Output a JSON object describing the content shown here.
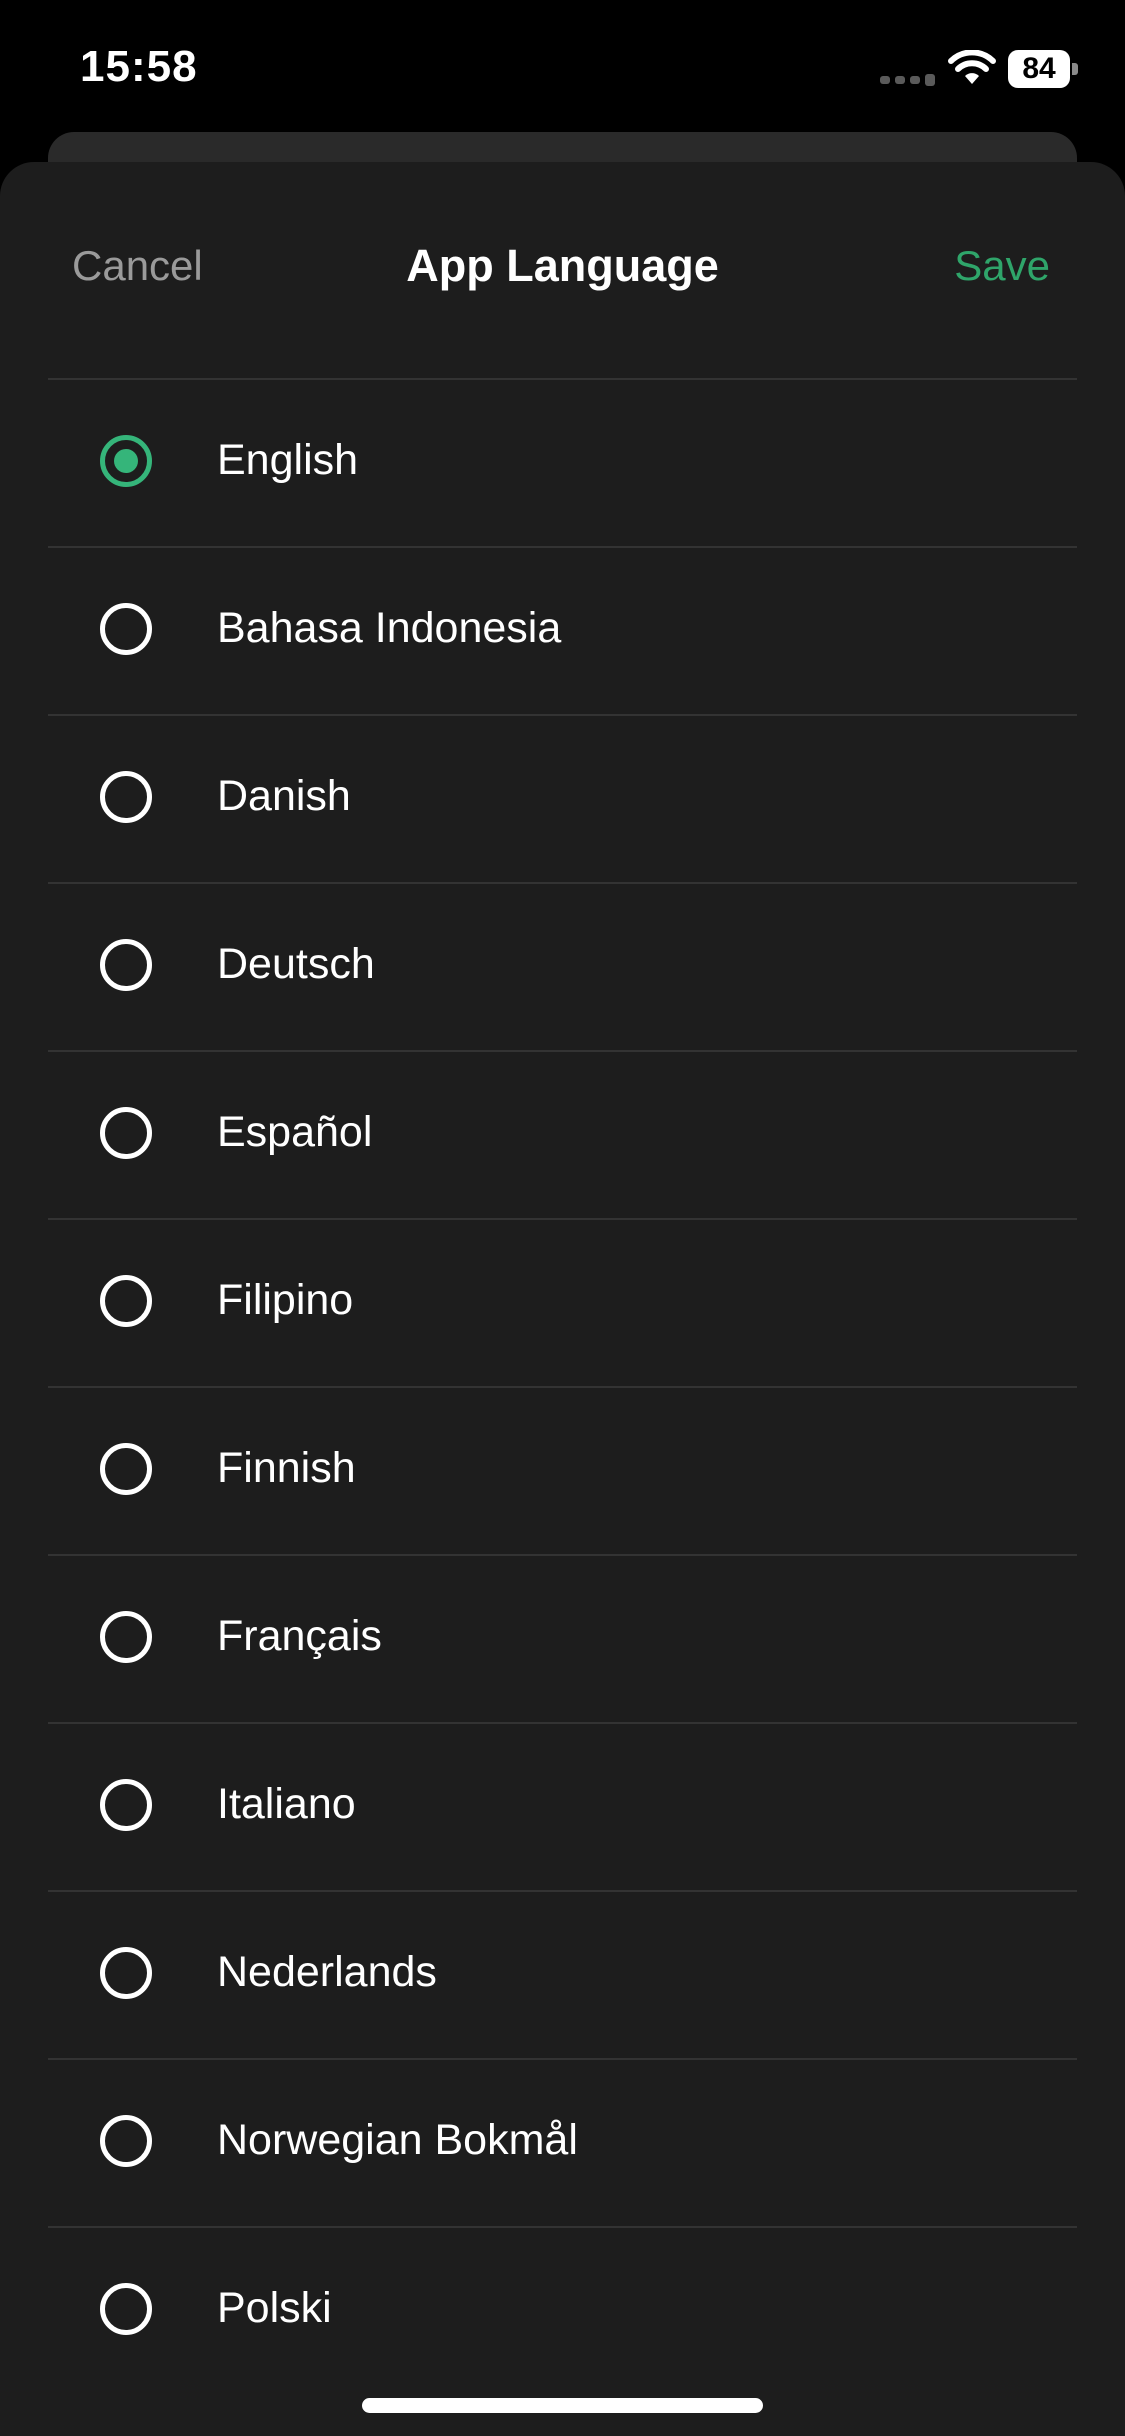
{
  "status_bar": {
    "time": "15:58",
    "battery": "84",
    "icons": [
      "signal-icon",
      "wifi-icon",
      "battery-icon"
    ]
  },
  "nav": {
    "cancel_label": "Cancel",
    "title": "App Language",
    "save_label": "Save"
  },
  "languages": [
    {
      "label": "English",
      "selected": true
    },
    {
      "label": "Bahasa Indonesia",
      "selected": false
    },
    {
      "label": "Danish",
      "selected": false
    },
    {
      "label": "Deutsch",
      "selected": false
    },
    {
      "label": "Español",
      "selected": false
    },
    {
      "label": "Filipino",
      "selected": false
    },
    {
      "label": "Finnish",
      "selected": false
    },
    {
      "label": "Français",
      "selected": false
    },
    {
      "label": "Italiano",
      "selected": false
    },
    {
      "label": "Nederlands",
      "selected": false
    },
    {
      "label": "Norwegian Bokmål",
      "selected": false
    },
    {
      "label": "Polski",
      "selected": false
    }
  ],
  "colors": {
    "accent": "#35b57a",
    "save_text": "#2fa56a",
    "sheet_background": "#1d1d1d",
    "separator": "#333333"
  }
}
